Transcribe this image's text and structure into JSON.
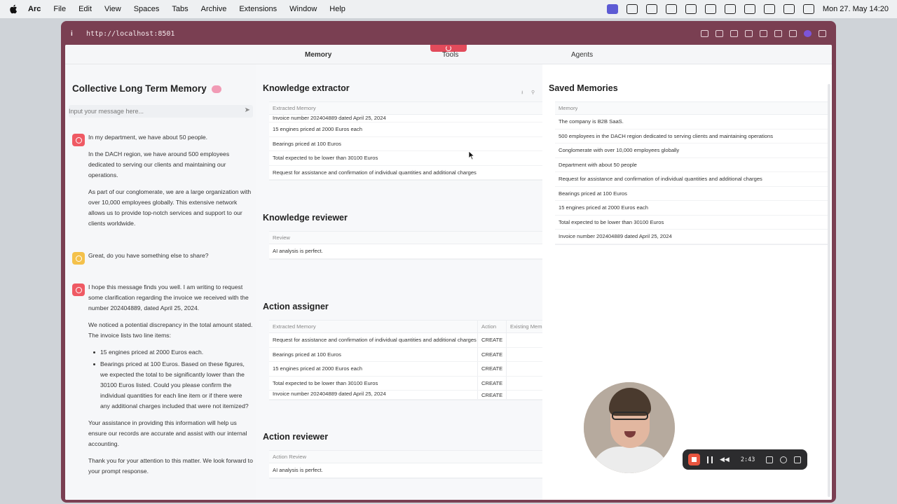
{
  "menubar": {
    "app": "Arc",
    "items": [
      "File",
      "Edit",
      "View",
      "Spaces",
      "Tabs",
      "Archive",
      "Extensions",
      "Window",
      "Help"
    ],
    "clock": "Mon 27. May  14:20"
  },
  "browser": {
    "url": "http://localhost:8501",
    "tabs": [
      "Memory",
      "Tools",
      "Agents"
    ]
  },
  "chat": {
    "title": "Collective Long Term Memory",
    "input_placeholder": "Input your message here...",
    "messages": [
      {
        "role": "user",
        "paragraphs": [
          "In my department, we have about 50 people.",
          "In the DACH region, we have around 500 employees dedicated to serving our clients and maintaining our operations.",
          "As part of our conglomerate, we are a large organization with over 10,000 employees globally. This extensive network allows us to provide top-notch services and support to our clients worldwide."
        ]
      },
      {
        "role": "assistant",
        "paragraphs": [
          "Great, do you have something else to share?"
        ]
      },
      {
        "role": "user",
        "paragraphs": [
          "I hope this message finds you well. I am writing to request some clarification regarding the invoice we received with the number 202404889, dated April 25, 2024.",
          "We noticed a potential discrepancy in the total amount stated. The invoice lists two line items:"
        ],
        "bullets": [
          "15 engines priced at 2000 Euros each.",
          "Bearings priced at 100 Euros. Based on these figures, we expected the total to be significantly lower than the 30100 Euros listed. Could you please confirm the individual quantities for each line item or if there were any additional charges included that were not itemized?"
        ],
        "after": [
          "Your assistance in providing this information will help us ensure our records are accurate and assist with our internal accounting.",
          "Thank you for your attention to this matter. We look forward to your prompt response."
        ]
      }
    ]
  },
  "extractor": {
    "title": "Knowledge extractor",
    "column": "Extracted Memory",
    "rows": [
      "Invoice number 202404889 dated April 25, 2024",
      "15 engines priced at 2000 Euros each",
      "Bearings priced at 100 Euros",
      "Total expected to be lower than 30100 Euros",
      "Request for assistance and confirmation of individual quantities and additional charges"
    ]
  },
  "reviewer": {
    "title": "Knowledge reviewer",
    "column": "Review",
    "rows": [
      "AI analysis is perfect."
    ]
  },
  "assigner": {
    "title": "Action assigner",
    "columns": [
      "Extracted Memory",
      "Action",
      "Existing Memo"
    ],
    "rows": [
      [
        "Request for assistance and confirmation of individual quantities and additional charges",
        "CREATE"
      ],
      [
        "Bearings priced at 100 Euros",
        "CREATE"
      ],
      [
        "15 engines priced at 2000 Euros each",
        "CREATE"
      ],
      [
        "Total expected to be lower than 30100 Euros",
        "CREATE"
      ],
      [
        "Invoice number 202404889 dated April 25, 2024",
        "CREATE"
      ]
    ]
  },
  "action_reviewer": {
    "title": "Action reviewer",
    "column": "Action Review",
    "rows": [
      "AI analysis is perfect."
    ]
  },
  "saved": {
    "title": "Saved Memories",
    "column": "Memory",
    "rows": [
      "The company is B2B SaaS.",
      "500 employees in the DACH region dedicated to serving clients and maintaining operations",
      "Conglomerate with over 10,000 employees globally",
      "Department with about 50 people",
      "Request for assistance and confirmation of individual quantities and additional charges",
      "Bearings priced at 100 Euros",
      "15 engines priced at 2000 Euros each",
      "Total expected to be lower than 30100 Euros",
      "Invoice number 202404889 dated April 25, 2024"
    ]
  },
  "recorder": {
    "time": "2:43"
  }
}
